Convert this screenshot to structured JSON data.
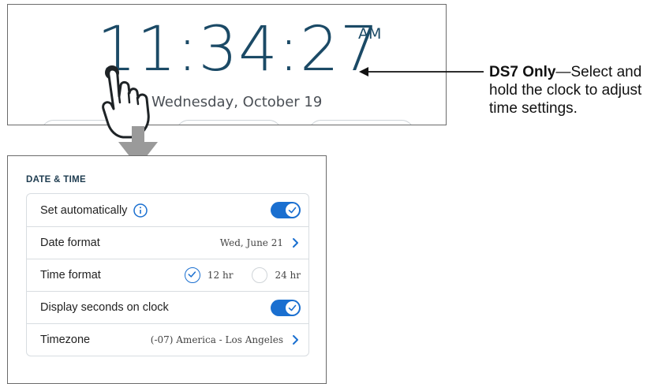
{
  "clock": {
    "time": "11:34:27",
    "ampm": "AM",
    "date": "Wednesday, October 19"
  },
  "callout": {
    "bold": "DS7 Only",
    "rest": "—Select and hold the clock to adjust time settings."
  },
  "settings": {
    "section_title": "DATE & TIME",
    "set_automatically": {
      "label": "Set automatically",
      "on": true
    },
    "date_format": {
      "label": "Date format",
      "value": "Wed, June 21"
    },
    "time_format": {
      "label": "Time format",
      "opt12": "12 hr",
      "opt24": "24 hr",
      "selected": "12 hr"
    },
    "display_seconds": {
      "label": "Display seconds on clock",
      "on": true
    },
    "timezone": {
      "label": "Timezone",
      "value": "(-07) America - Los Angeles"
    }
  },
  "colors": {
    "accent": "#1a6fd0",
    "clock_text": "#1b4a66",
    "arrow": "#9a9a9a"
  }
}
